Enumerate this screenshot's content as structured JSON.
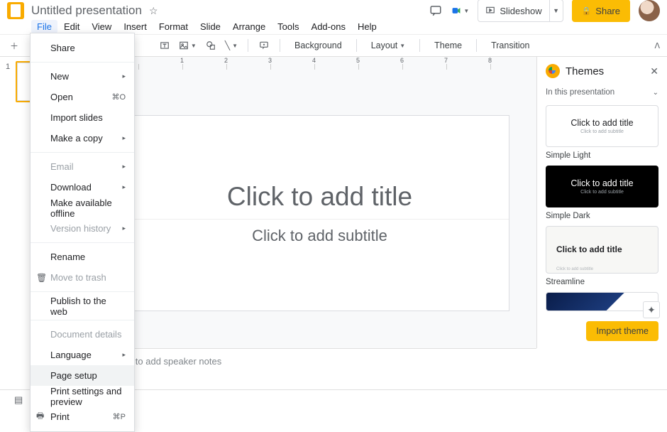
{
  "header": {
    "title": "Untitled presentation",
    "slideshow": "Slideshow",
    "share": "Share"
  },
  "menubar": [
    "File",
    "Edit",
    "View",
    "Insert",
    "Format",
    "Slide",
    "Arrange",
    "Tools",
    "Add-ons",
    "Help"
  ],
  "toolbar": {
    "background": "Background",
    "layout": "Layout",
    "theme": "Theme",
    "transition": "Transition"
  },
  "slide": {
    "title_ph": "Click to add title",
    "sub_ph": "Click to add subtitle",
    "notes_ph": "Click to add speaker notes",
    "thumb_num": "1"
  },
  "themes": {
    "title": "Themes",
    "section": "In this presentation",
    "cards": [
      {
        "title": "Click to add title",
        "sub": "Click to add subtitle",
        "name": "Simple Light"
      },
      {
        "title": "Click to add title",
        "sub": "Click to add subtitle",
        "name": "Simple Dark"
      },
      {
        "title": "Click to add title",
        "sub": "Click to add subtitle",
        "name": "Streamline"
      }
    ],
    "import": "Import theme"
  },
  "file_menu": {
    "share": "Share",
    "new": "New",
    "open": "Open",
    "open_sc": "⌘O",
    "import": "Import slides",
    "copy": "Make a copy",
    "email": "Email",
    "download": "Download",
    "offline": "Make available offline",
    "history": "Version history",
    "rename": "Rename",
    "trash": "Move to trash",
    "publish": "Publish to the web",
    "details": "Document details",
    "language": "Language",
    "pagesetup": "Page setup",
    "printprev": "Print settings and preview",
    "print": "Print",
    "print_sc": "⌘P"
  },
  "ruler": [
    "1",
    "2",
    "3",
    "4",
    "5",
    "6",
    "7",
    "8"
  ]
}
